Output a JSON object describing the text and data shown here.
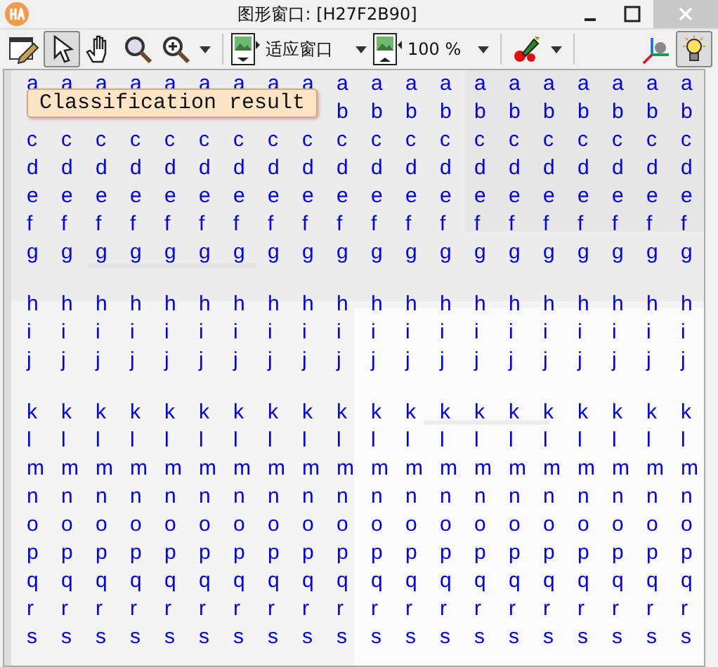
{
  "window": {
    "title": "图形窗口: [H27F2B90]"
  },
  "toolbar": {
    "tools": [
      {
        "selected": false
      },
      {
        "selected": true
      },
      {
        "selected": false
      },
      {
        "selected": false
      },
      {
        "selected": false
      }
    ],
    "fit_dropdown": {
      "value": "适应窗口"
    },
    "zoom_dropdown": {
      "value": "100 %"
    },
    "light_selected": true
  },
  "tooltip": "Classification result",
  "groups": [
    {
      "rows": [
        [
          "a",
          "a",
          "a",
          "a",
          "a",
          "a",
          "a",
          "a",
          "a",
          "a",
          "a",
          "a",
          "a",
          "a",
          "a",
          "a",
          "a",
          "a",
          "a",
          "a"
        ],
        [
          "",
          "",
          "",
          "",
          "",
          "",
          "",
          "",
          "",
          "b",
          "b",
          "b",
          "b",
          "b",
          "b",
          "b",
          "b",
          "b",
          "b",
          "b"
        ],
        [
          "c",
          "c",
          "c",
          "c",
          "c",
          "c",
          "c",
          "c",
          "c",
          "c",
          "c",
          "c",
          "c",
          "c",
          "c",
          "c",
          "c",
          "c",
          "c",
          "c"
        ],
        [
          "d",
          "d",
          "d",
          "d",
          "d",
          "d",
          "d",
          "d",
          "d",
          "d",
          "d",
          "d",
          "d",
          "d",
          "d",
          "d",
          "d",
          "d",
          "d",
          "d"
        ],
        [
          "e",
          "e",
          "e",
          "e",
          "e",
          "e",
          "e",
          "e",
          "e",
          "e",
          "e",
          "e",
          "e",
          "e",
          "e",
          "e",
          "e",
          "e",
          "e",
          "e"
        ],
        [
          "f",
          "f",
          "f",
          "f",
          "f",
          "f",
          "f",
          "f",
          "f",
          "f",
          "f",
          "f",
          "f",
          "f",
          "f",
          "f",
          "f",
          "f",
          "f",
          "f"
        ],
        [
          "g",
          "g",
          "g",
          "g",
          "g",
          "g",
          "g",
          "g",
          "g",
          "g",
          "g",
          "g",
          "g",
          "g",
          "g",
          "g",
          "g",
          "g",
          "g",
          "g"
        ]
      ]
    },
    {
      "rows": [
        [
          "h",
          "h",
          "h",
          "h",
          "h",
          "h",
          "h",
          "h",
          "h",
          "h",
          "h",
          "h",
          "h",
          "h",
          "h",
          "h",
          "h",
          "h",
          "h",
          "h"
        ],
        [
          "i",
          "i",
          "i",
          "i",
          "i",
          "i",
          "i",
          "i",
          "i",
          "i",
          "i",
          "i",
          "i",
          "i",
          "i",
          "i",
          "i",
          "i",
          "i",
          "i"
        ],
        [
          "j",
          "j",
          "j",
          "j",
          "j",
          "j",
          "j",
          "j",
          "j",
          "j",
          "j",
          "j",
          "j",
          "j",
          "j",
          "j",
          "j",
          "j",
          "j",
          "j"
        ]
      ]
    },
    {
      "rows": [
        [
          "k",
          "k",
          "k",
          "k",
          "k",
          "k",
          "k",
          "k",
          "k",
          "k",
          "k",
          "k",
          "k",
          "k",
          "k",
          "k",
          "k",
          "k",
          "k",
          "k"
        ],
        [
          "l",
          "l",
          "l",
          "l",
          "l",
          "l",
          "l",
          "l",
          "l",
          "l",
          "l",
          "l",
          "l",
          "l",
          "l",
          "l",
          "l",
          "l",
          "l",
          "l"
        ],
        [
          "m",
          "m",
          "m",
          "m",
          "m",
          "m",
          "m",
          "m",
          "m",
          "m",
          "m",
          "m",
          "m",
          "m",
          "m",
          "m",
          "m",
          "m",
          "m",
          "m"
        ],
        [
          "n",
          "n",
          "n",
          "n",
          "n",
          "n",
          "n",
          "n",
          "n",
          "n",
          "n",
          "n",
          "n",
          "n",
          "n",
          "n",
          "n",
          "n",
          "n",
          "n"
        ],
        [
          "o",
          "o",
          "o",
          "o",
          "o",
          "o",
          "o",
          "o",
          "o",
          "o",
          "o",
          "o",
          "o",
          "o",
          "o",
          "o",
          "o",
          "o",
          "o",
          "o"
        ],
        [
          "p",
          "p",
          "p",
          "p",
          "p",
          "p",
          "p",
          "p",
          "p",
          "p",
          "p",
          "p",
          "p",
          "p",
          "p",
          "p",
          "p",
          "p",
          "p",
          "p"
        ],
        [
          "q",
          "q",
          "q",
          "q",
          "q",
          "q",
          "q",
          "q",
          "q",
          "q",
          "q",
          "q",
          "q",
          "q",
          "q",
          "q",
          "q",
          "q",
          "q",
          "q"
        ],
        [
          "r",
          "r",
          "r",
          "r",
          "r",
          "r",
          "r",
          "r",
          "r",
          "r",
          "r",
          "r",
          "r",
          "r",
          "r",
          "r",
          "r",
          "r",
          "r",
          "r"
        ],
        [
          "s",
          "s",
          "s",
          "s",
          "s",
          "s",
          "s",
          "s",
          "s",
          "s",
          "s",
          "s",
          "s",
          "s",
          "s",
          "s",
          "s",
          "s",
          "s",
          "s"
        ]
      ]
    }
  ]
}
